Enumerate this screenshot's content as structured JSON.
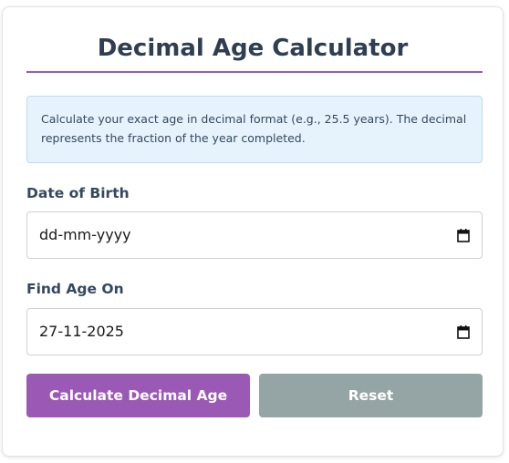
{
  "title": "Decimal Age Calculator",
  "info_text": "Calculate your exact age in decimal format (e.g., 25.5 years). The decimal represents the fraction of the year completed.",
  "fields": {
    "date_of_birth": {
      "label": "Date of Birth",
      "display": "dd-mm-yyyy",
      "icon": "calendar-icon"
    },
    "find_age_on": {
      "label": "Find Age On",
      "display": "27-11-2025",
      "icon": "calendar-icon"
    }
  },
  "buttons": {
    "calculate_label": "Calculate Decimal Age",
    "reset_label": "Reset"
  },
  "colors": {
    "accent": "#9b59b6",
    "reset": "#95a5a6",
    "heading": "#2f3e50",
    "info_bg": "#e7f3fc",
    "info_border": "#b9dcf3"
  }
}
